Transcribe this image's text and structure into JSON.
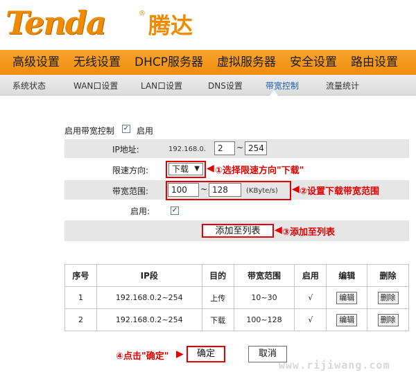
{
  "brand": {
    "logo": "Tenda",
    "logo_cn": "腾达",
    "reg_mark": "®"
  },
  "main_nav": [
    "高级设置",
    "无线设置",
    "DHCP服务器",
    "虚拟服务器",
    "安全设置",
    "路由设置"
  ],
  "sub_nav": [
    "系统状态",
    "WAN口设置",
    "LAN口设置",
    "DNS设置",
    "带宽控制",
    "流量统计"
  ],
  "sub_nav_active": "带宽控制",
  "form": {
    "enable_bw_label": "启用带宽控制",
    "enable_bw_checked": "✓",
    "enable_text": "启用",
    "ip_label": "IP地址:",
    "ip_prefix": "192.168.0.",
    "ip_start": "2",
    "ip_sep": "~",
    "ip_end": "254",
    "direction_label": "限速方向:",
    "direction_value": "下载",
    "bw_label": "带宽范围:",
    "bw_min": "100",
    "bw_sep": "~",
    "bw_max": "128",
    "bw_unit": "(KByte/s)",
    "enable_label": "启用:",
    "enable_checked": "✓",
    "add_button": "添加至列表"
  },
  "annotations": {
    "a1": "①选择限速方向\"下载\"",
    "a2": "②设置下载带宽范围",
    "a3": "③添加至列表",
    "a4": "④点击\"确定\""
  },
  "table": {
    "headers": [
      "序号",
      "IP段",
      "目的",
      "带宽范围",
      "启用",
      "编辑",
      "删除"
    ],
    "rows": [
      [
        "1",
        "192.168.0.2~254",
        "上传",
        "10~30",
        "√",
        "编辑",
        "删除"
      ],
      [
        "2",
        "192.168.0.2~254",
        "下载",
        "100~128",
        "√",
        "编辑",
        "删除"
      ]
    ]
  },
  "buttons": {
    "ok": "确定",
    "cancel": "取消"
  },
  "watermark": "www.rijiwang.com",
  "colors": {
    "nav_orange": "#f08c0f",
    "active_tab": "#1d5fb8",
    "annotation_red": "#e30000"
  }
}
